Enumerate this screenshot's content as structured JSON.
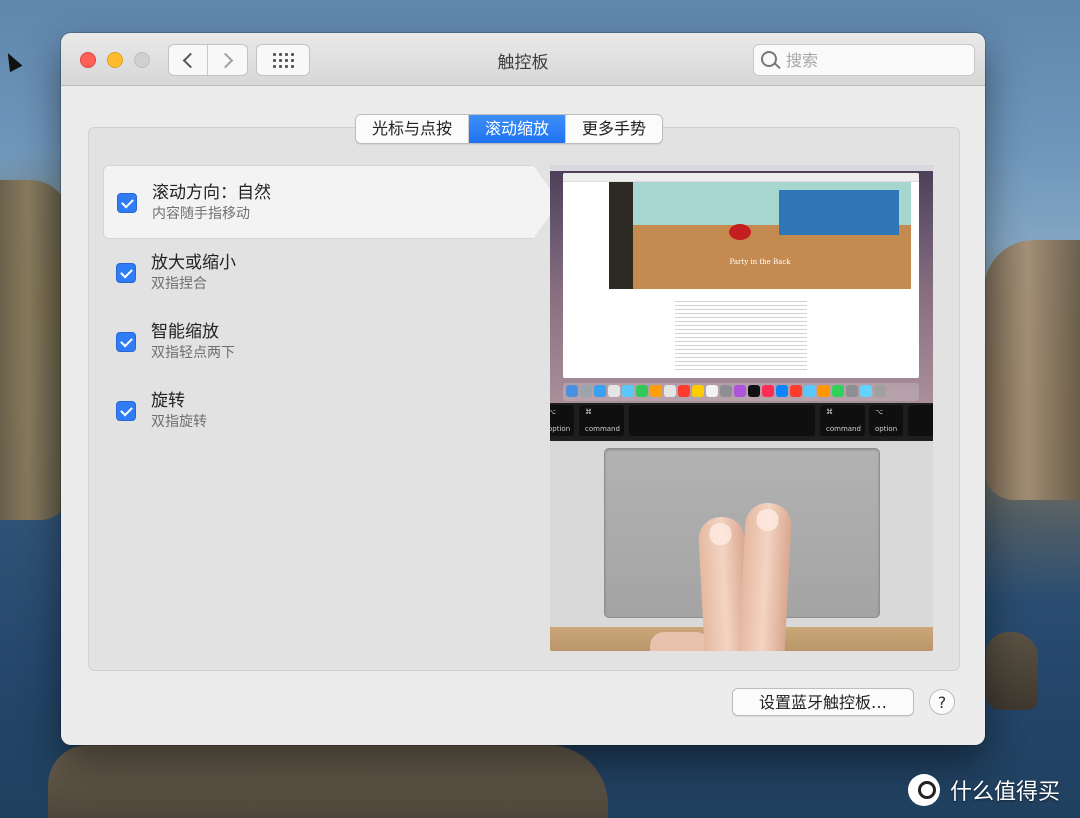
{
  "window": {
    "title": "触控板"
  },
  "search": {
    "placeholder": "搜索"
  },
  "tabs": [
    {
      "label": "光标与点按",
      "active": false
    },
    {
      "label": "滚动缩放",
      "active": true
    },
    {
      "label": "更多手势",
      "active": false
    }
  ],
  "options": [
    {
      "title": "滚动方向：自然",
      "subtitle": "内容随手指移动",
      "checked": true,
      "selected": true
    },
    {
      "title": "放大或缩小",
      "subtitle": "双指捏合",
      "checked": true,
      "selected": false
    },
    {
      "title": "智能缩放",
      "subtitle": "双指轻点两下",
      "checked": true,
      "selected": false
    },
    {
      "title": "旋转",
      "subtitle": "双指旋转",
      "checked": true,
      "selected": false
    }
  ],
  "preview": {
    "hero_caption": "Party in the Back",
    "keys": {
      "option_left": {
        "symbol": "⌥",
        "label": "option"
      },
      "command_left": {
        "symbol": "⌘",
        "label": "command"
      },
      "command_right": {
        "symbol": "⌘",
        "label": "command"
      },
      "option_right": {
        "symbol": "⌥",
        "label": "option"
      }
    }
  },
  "footer": {
    "bluetooth_button": "设置蓝牙触控板…",
    "help_button": "?"
  },
  "watermark": {
    "text": "什么值得买"
  },
  "colors": {
    "accent": "#2f7cf6",
    "close": "#fe5f57",
    "minimize": "#febc2e"
  }
}
